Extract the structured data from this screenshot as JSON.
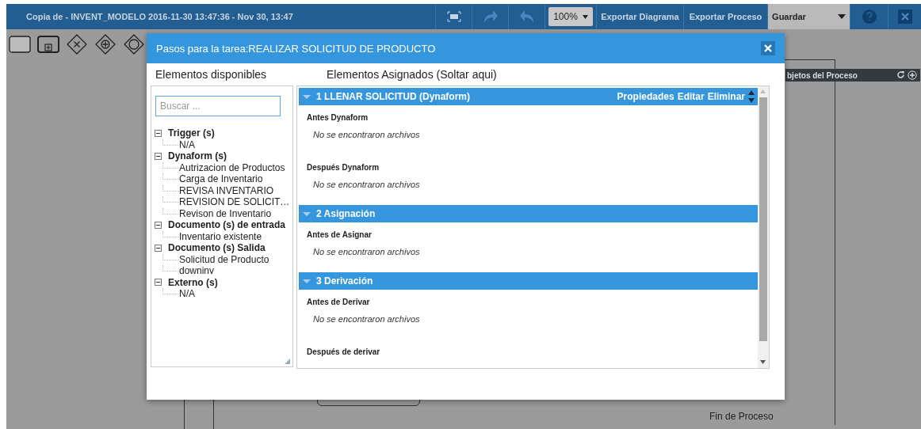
{
  "topbar": {
    "title": "Copia de - INVENT_MODELO 2016-11-30 13:47:36 - Nov 30, 13:47",
    "zoom": "100%",
    "buttons": [
      "Exportar Diagrama",
      "Exportar Proceso"
    ],
    "save": "Guardar"
  },
  "canvas": {
    "panel_title": "bjetos del Proceso",
    "labels": [
      "Fin de Proceso"
    ]
  },
  "modal": {
    "title": "Pasos para la tarea:REALIZAR SOLICITUD DE PRODUCTO",
    "left_heading": "Elementos disponibles",
    "right_heading": "Elementos Asignados (Soltar aqui)",
    "search": {
      "placeholder": "Buscar ..."
    },
    "tree": [
      {
        "label": "Trigger (s)",
        "expanded": true,
        "children": [
          "N/A"
        ]
      },
      {
        "label": "Dynaform (s)",
        "expanded": true,
        "children": [
          "Autrizacion de Productos",
          "Carga de Inventario",
          "REVISA INVENTARIO",
          "REVISION DE SOLICIT…",
          "Revison de Inventario"
        ]
      },
      {
        "label": "Documento (s) de entrada",
        "expanded": true,
        "children": [
          "Inventario existente"
        ]
      },
      {
        "label": "Documento (s) Salida",
        "expanded": true,
        "children": [
          "Solicitud de Producto",
          "downinv"
        ]
      },
      {
        "label": "Externo (s)",
        "expanded": true,
        "children": [
          "N/A"
        ]
      }
    ],
    "steps": [
      {
        "title": "1 LLENAR SOLICITUD (Dynaform)",
        "expanded": true,
        "actions": [
          "Propiedades",
          "Editar",
          "Eliminar"
        ],
        "sections": [
          {
            "label": "Antes Dynaform",
            "empty_text": "No se encontraron archivos"
          },
          {
            "label": "Después Dynaform",
            "empty_text": "No se encontraron archivos"
          }
        ]
      },
      {
        "title": "2 Asignación",
        "expanded": true,
        "sections": [
          {
            "label": "Antes de Asignar",
            "empty_text": "No se encontraron archivos"
          }
        ]
      },
      {
        "title": "3 Derivación",
        "expanded": true,
        "sections": [
          {
            "label": "Antes de Derivar",
            "empty_text": "No se encontraron archivos"
          },
          {
            "label": "Después de derivar"
          }
        ]
      }
    ]
  }
}
